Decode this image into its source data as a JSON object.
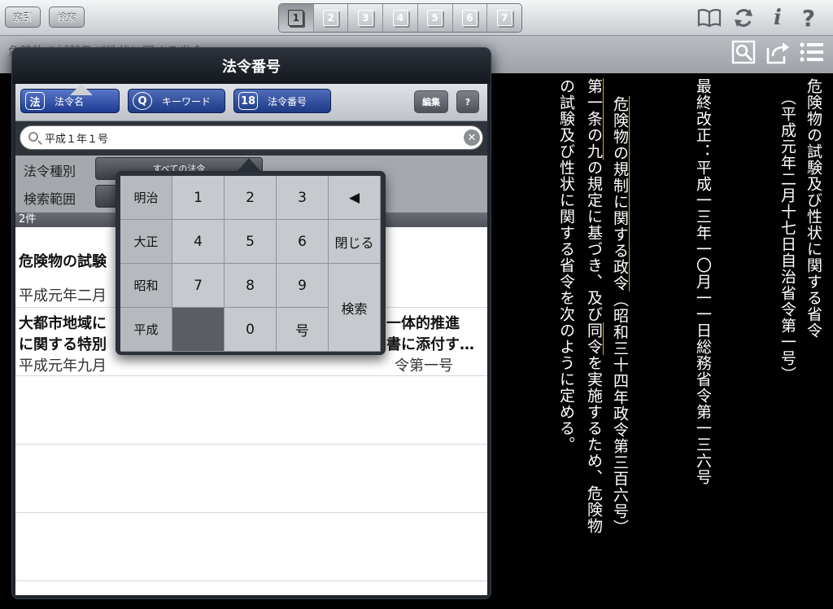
{
  "topbar": {
    "index_button": "索引",
    "search_button": "検索",
    "pages": [
      "1",
      "2",
      "3",
      "4",
      "5",
      "6",
      "7"
    ],
    "selected_page": 0
  },
  "doc": {
    "title": "危険物の試験及び性状に関する省令",
    "header_title": "危険物の試験及び性状に関する省令",
    "promulgation": "（平成元年二月十七日自治省令第一号）",
    "last_revision": "最終改正：平成一三年一〇月一一日総務省令第一三六号",
    "body_col1_link": "危険物の規制に関する政令",
    "body_col1_rest": "（昭和三十四年政令第三百六号）",
    "body_col2_link1": "第一条の九",
    "body_col2_mid": "の規定に基づき、及び",
    "body_col2_link2": "同令",
    "body_col2_rest": "を実施するため、危険物",
    "body_col3": "の試験及び性状に関する省令を次のように定める。"
  },
  "popover": {
    "title": "法令番号",
    "tabs": [
      {
        "icon": "法",
        "label": "法令名"
      },
      {
        "icon": "Q",
        "label": "キーワード"
      },
      {
        "icon": "18",
        "label": "法令番号"
      }
    ],
    "edit_button": "編集",
    "help_button": "?",
    "search": {
      "value": "平成１年１号",
      "placeholder": ""
    },
    "filters": {
      "type_label": "法令種別",
      "type_value": "すべての法令",
      "scope_label": "検索範囲"
    },
    "count": "2件",
    "results": [
      {
        "title": "危険物の試験",
        "sub": "平成元年二月"
      },
      {
        "title": "大都市地域に",
        "title2": "に関する特別",
        "title_tail": "一体的推進",
        "title2_tail": "書に添付す…",
        "sub": "平成元年九月"
      }
    ],
    "result2_sub_tail": "令第一号"
  },
  "keypad": {
    "eras": [
      "明治",
      "大正",
      "昭和",
      "平成"
    ],
    "digits": [
      "1",
      "2",
      "3",
      "4",
      "5",
      "6",
      "7",
      "8",
      "9",
      "0"
    ],
    "go_label": "号",
    "close_label": "閉じる",
    "search_label": "検索",
    "back_label": "◀"
  }
}
